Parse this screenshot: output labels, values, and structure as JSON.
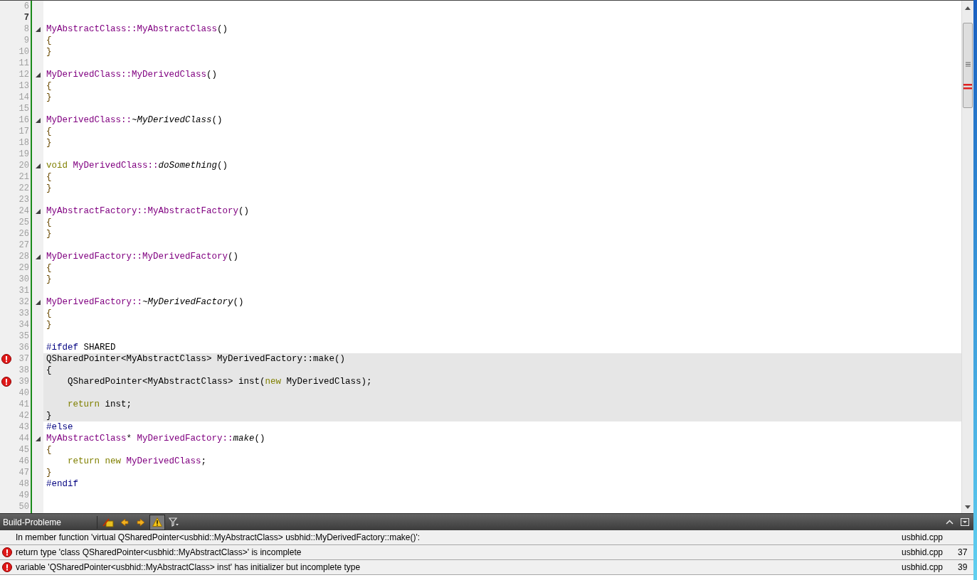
{
  "editor": {
    "lines": [
      {
        "number": "6",
        "current": false,
        "fold": false,
        "error": false,
        "highlighted": false
      },
      {
        "number": "7",
        "current": true,
        "fold": false,
        "error": false,
        "highlighted": false
      },
      {
        "number": "8",
        "current": false,
        "fold": true,
        "error": false,
        "highlighted": false,
        "tokens": [
          {
            "kind": "type",
            "text": "MyAbstractClass::MyAbstractClass"
          },
          {
            "kind": "plain",
            "text": "()"
          }
        ]
      },
      {
        "number": "9",
        "current": false,
        "fold": false,
        "error": false,
        "highlighted": false,
        "tokens": [
          {
            "kind": "brace",
            "text": "{"
          }
        ]
      },
      {
        "number": "10",
        "current": false,
        "fold": false,
        "error": false,
        "highlighted": false,
        "tokens": [
          {
            "kind": "brace",
            "text": "}"
          }
        ]
      },
      {
        "number": "11",
        "current": false,
        "fold": false,
        "error": false,
        "highlighted": false
      },
      {
        "number": "12",
        "current": false,
        "fold": true,
        "error": false,
        "highlighted": false,
        "tokens": [
          {
            "kind": "type",
            "text": "MyDerivedClass::MyDerivedClass"
          },
          {
            "kind": "plain",
            "text": "()"
          }
        ]
      },
      {
        "number": "13",
        "current": false,
        "fold": false,
        "error": false,
        "highlighted": false,
        "tokens": [
          {
            "kind": "brace",
            "text": "{"
          }
        ]
      },
      {
        "number": "14",
        "current": false,
        "fold": false,
        "error": false,
        "highlighted": false,
        "tokens": [
          {
            "kind": "brace",
            "text": "}"
          }
        ]
      },
      {
        "number": "15",
        "current": false,
        "fold": false,
        "error": false,
        "highlighted": false
      },
      {
        "number": "16",
        "current": false,
        "fold": true,
        "error": false,
        "highlighted": false,
        "tokens": [
          {
            "kind": "type",
            "text": "MyDerivedClass::"
          },
          {
            "kind": "italic",
            "text": "~MyDerivedClass"
          },
          {
            "kind": "plain",
            "text": "()"
          }
        ]
      },
      {
        "number": "17",
        "current": false,
        "fold": false,
        "error": false,
        "highlighted": false,
        "tokens": [
          {
            "kind": "brace",
            "text": "{"
          }
        ]
      },
      {
        "number": "18",
        "current": false,
        "fold": false,
        "error": false,
        "highlighted": false,
        "tokens": [
          {
            "kind": "brace",
            "text": "}"
          }
        ]
      },
      {
        "number": "19",
        "current": false,
        "fold": false,
        "error": false,
        "highlighted": false
      },
      {
        "number": "20",
        "current": false,
        "fold": true,
        "error": false,
        "highlighted": false,
        "tokens": [
          {
            "kind": "keyword",
            "text": "void "
          },
          {
            "kind": "type",
            "text": "MyDerivedClass::"
          },
          {
            "kind": "italic",
            "text": "doSomething"
          },
          {
            "kind": "plain",
            "text": "()"
          }
        ]
      },
      {
        "number": "21",
        "current": false,
        "fold": false,
        "error": false,
        "highlighted": false,
        "tokens": [
          {
            "kind": "brace",
            "text": "{"
          }
        ]
      },
      {
        "number": "22",
        "current": false,
        "fold": false,
        "error": false,
        "highlighted": false,
        "tokens": [
          {
            "kind": "brace",
            "text": "}"
          }
        ]
      },
      {
        "number": "23",
        "current": false,
        "fold": false,
        "error": false,
        "highlighted": false
      },
      {
        "number": "24",
        "current": false,
        "fold": true,
        "error": false,
        "highlighted": false,
        "tokens": [
          {
            "kind": "type",
            "text": "MyAbstractFactory::MyAbstractFactory"
          },
          {
            "kind": "plain",
            "text": "()"
          }
        ]
      },
      {
        "number": "25",
        "current": false,
        "fold": false,
        "error": false,
        "highlighted": false,
        "tokens": [
          {
            "kind": "brace",
            "text": "{"
          }
        ]
      },
      {
        "number": "26",
        "current": false,
        "fold": false,
        "error": false,
        "highlighted": false,
        "tokens": [
          {
            "kind": "brace",
            "text": "}"
          }
        ]
      },
      {
        "number": "27",
        "current": false,
        "fold": false,
        "error": false,
        "highlighted": false
      },
      {
        "number": "28",
        "current": false,
        "fold": true,
        "error": false,
        "highlighted": false,
        "tokens": [
          {
            "kind": "type",
            "text": "MyDerivedFactory::MyDerivedFactory"
          },
          {
            "kind": "plain",
            "text": "()"
          }
        ]
      },
      {
        "number": "29",
        "current": false,
        "fold": false,
        "error": false,
        "highlighted": false,
        "tokens": [
          {
            "kind": "brace",
            "text": "{"
          }
        ]
      },
      {
        "number": "30",
        "current": false,
        "fold": false,
        "error": false,
        "highlighted": false,
        "tokens": [
          {
            "kind": "brace",
            "text": "}"
          }
        ]
      },
      {
        "number": "31",
        "current": false,
        "fold": false,
        "error": false,
        "highlighted": false
      },
      {
        "number": "32",
        "current": false,
        "fold": true,
        "error": false,
        "highlighted": false,
        "tokens": [
          {
            "kind": "type",
            "text": "MyDerivedFactory::"
          },
          {
            "kind": "italic",
            "text": "~MyDerivedFactory"
          },
          {
            "kind": "plain",
            "text": "()"
          }
        ]
      },
      {
        "number": "33",
        "current": false,
        "fold": false,
        "error": false,
        "highlighted": false,
        "tokens": [
          {
            "kind": "brace",
            "text": "{"
          }
        ]
      },
      {
        "number": "34",
        "current": false,
        "fold": false,
        "error": false,
        "highlighted": false,
        "tokens": [
          {
            "kind": "brace",
            "text": "}"
          }
        ]
      },
      {
        "number": "35",
        "current": false,
        "fold": false,
        "error": false,
        "highlighted": false
      },
      {
        "number": "36",
        "current": false,
        "fold": false,
        "error": false,
        "highlighted": false,
        "tokens": [
          {
            "kind": "preproc",
            "text": "#ifdef "
          },
          {
            "kind": "plain",
            "text": "SHARED"
          }
        ]
      },
      {
        "number": "37",
        "current": false,
        "fold": false,
        "error": true,
        "highlighted": true,
        "tokens": [
          {
            "kind": "plain",
            "text": "QSharedPointer<MyAbstractClass> MyDerivedFactory::make()"
          }
        ]
      },
      {
        "number": "38",
        "current": false,
        "fold": false,
        "error": false,
        "highlighted": true,
        "tokens": [
          {
            "kind": "plain",
            "text": "{"
          }
        ]
      },
      {
        "number": "39",
        "current": false,
        "fold": false,
        "error": true,
        "highlighted": true,
        "indented": true,
        "tokens": [
          {
            "kind": "plain",
            "text": "QSharedPointer<MyAbstractClass> inst("
          },
          {
            "kind": "keyword",
            "text": "new"
          },
          {
            "kind": "plain",
            "text": " MyDerivedClass);"
          }
        ]
      },
      {
        "number": "40",
        "current": false,
        "fold": false,
        "error": false,
        "highlighted": true
      },
      {
        "number": "41",
        "current": false,
        "fold": false,
        "error": false,
        "highlighted": true,
        "indented": true,
        "tokens": [
          {
            "kind": "keyword",
            "text": "return"
          },
          {
            "kind": "plain",
            "text": " inst;"
          }
        ]
      },
      {
        "number": "42",
        "current": false,
        "fold": false,
        "error": false,
        "highlighted": true,
        "tokens": [
          {
            "kind": "plain",
            "text": "}"
          }
        ]
      },
      {
        "number": "43",
        "current": false,
        "fold": false,
        "error": false,
        "highlighted": false,
        "tokens": [
          {
            "kind": "preproc",
            "text": "#else"
          }
        ]
      },
      {
        "number": "44",
        "current": false,
        "fold": true,
        "error": false,
        "highlighted": false,
        "tokens": [
          {
            "kind": "type",
            "text": "MyAbstractClass"
          },
          {
            "kind": "plain",
            "text": "* "
          },
          {
            "kind": "type",
            "text": "MyDerivedFactory::"
          },
          {
            "kind": "italic",
            "text": "make"
          },
          {
            "kind": "plain",
            "text": "()"
          }
        ]
      },
      {
        "number": "45",
        "current": false,
        "fold": false,
        "error": false,
        "highlighted": false,
        "tokens": [
          {
            "kind": "brace",
            "text": "{"
          }
        ]
      },
      {
        "number": "46",
        "current": false,
        "fold": false,
        "error": false,
        "highlighted": false,
        "indented": true,
        "tokens": [
          {
            "kind": "keyword",
            "text": "return new "
          },
          {
            "kind": "type",
            "text": "MyDerivedClass"
          },
          {
            "kind": "plain",
            "text": ";"
          }
        ]
      },
      {
        "number": "47",
        "current": false,
        "fold": false,
        "error": false,
        "highlighted": false,
        "tokens": [
          {
            "kind": "brace",
            "text": "}"
          }
        ]
      },
      {
        "number": "48",
        "current": false,
        "fold": false,
        "error": false,
        "highlighted": false,
        "tokens": [
          {
            "kind": "preproc",
            "text": "#endif"
          }
        ]
      },
      {
        "number": "49",
        "current": false,
        "fold": false,
        "error": false,
        "highlighted": false
      },
      {
        "number": "50",
        "current": false,
        "fold": false,
        "error": false,
        "highlighted": false
      }
    ]
  },
  "panel": {
    "title": "Build-Probleme",
    "toolbar": [
      {
        "kind": "clear",
        "selected": false
      },
      {
        "kind": "prev",
        "selected": false
      },
      {
        "kind": "next",
        "selected": false
      },
      {
        "kind": "warning",
        "selected": true
      },
      {
        "kind": "filter",
        "selected": false
      }
    ],
    "problems": [
      {
        "kind": "info",
        "message": "In member function 'virtual QSharedPointer<usbhid::MyAbstractClass> usbhid::MyDerivedFactory::make()':",
        "file": "usbhid.cpp"
      },
      {
        "kind": "error",
        "message": "return type 'class QSharedPointer<usbhid::MyAbstractClass>' is incomplete",
        "file": "usbhid.cpp",
        "line": "37"
      },
      {
        "kind": "error",
        "message": "variable 'QSharedPointer<usbhid::MyAbstractClass> inst' has initializer but incomplete type",
        "file": "usbhid.cpp",
        "line": "39"
      }
    ]
  }
}
